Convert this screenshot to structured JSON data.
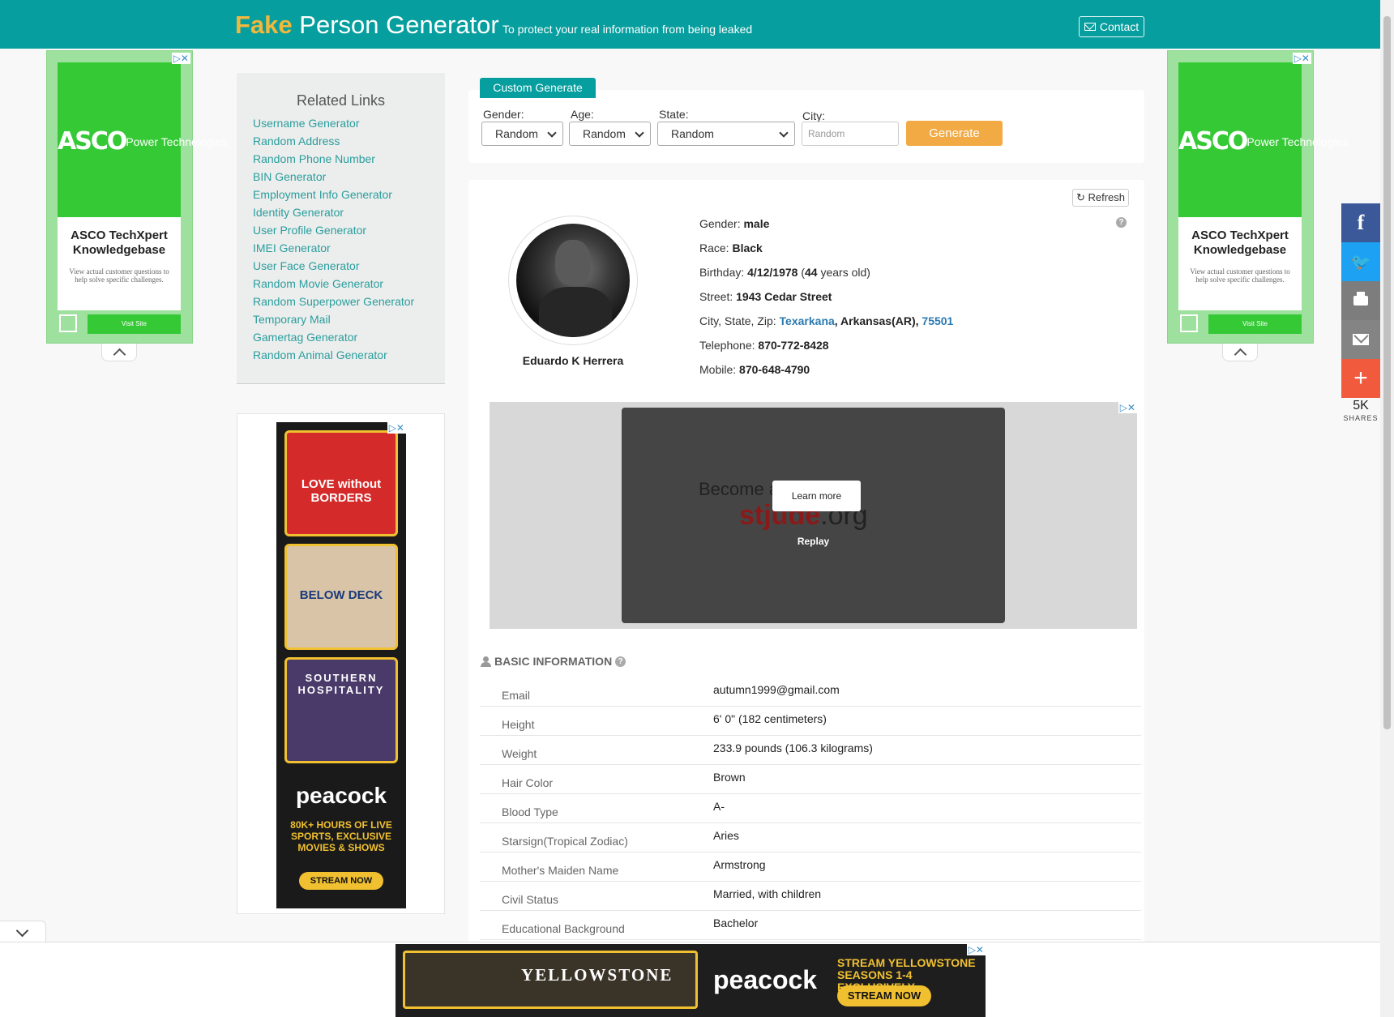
{
  "header": {
    "brand_fake": "Fake",
    "brand_rest": " Person Generator",
    "tagline": "To protect your real information from being leaked",
    "contact": "Contact"
  },
  "side_ads": {
    "logo_big": "ASCO",
    "logo_small": "Power Technologies",
    "title": "ASCO TechXpert Knowledgebase",
    "desc": "View actual customer questions to help solve specific challenges.",
    "visit": "Visit Site",
    "adchoice": "▷✕"
  },
  "related": {
    "title": "Related Links",
    "links": [
      "Username Generator",
      "Random Address",
      "Random Phone Number",
      "BIN Generator",
      "Employment Info Generator",
      "Identity Generator",
      "User Profile Generator",
      "IMEI Generator",
      "User Face Generator",
      "Random Movie Generator",
      "Random Superpower Generator",
      "Temporary Mail",
      "Gamertag Generator",
      "Random Animal Generator"
    ]
  },
  "sky_ad": {
    "img1": "LOVE without BORDERS",
    "img2": "BELOW DECK",
    "img3": "SOUTHERN HOSPITALITY",
    "logo": "peacock",
    "text": "80K+ HOURS OF LIVE SPORTS, EXCLUSIVE MOVIES & SHOWS",
    "cta": "STREAM NOW"
  },
  "custom": {
    "tab": "Custom Generate",
    "gender_label": "Gender:",
    "gender_value": "Random",
    "age_label": "Age:",
    "age_value": "Random",
    "state_label": "State:",
    "state_value": "Random",
    "city_label": "City:",
    "city_placeholder": "Random",
    "generate": "Generate"
  },
  "profile": {
    "refresh": "Refresh",
    "name": "Eduardo K Herrera",
    "gender_label": "Gender: ",
    "gender": "male",
    "race_label": "Race: ",
    "race": "Black",
    "birthday_label": "Birthday: ",
    "birthday": "4/12/1978",
    "age_open": " (",
    "age": "44",
    "age_close": " years old)",
    "street_label": "Street: ",
    "street": "1943 Cedar Street",
    "csz_label": "City, State, Zip: ",
    "city": "Texarkana",
    "state": ", Arkansas(AR), ",
    "zip": "75501",
    "tel_label": "Telephone: ",
    "tel": "870-772-8428",
    "mobile_label": "Mobile: ",
    "mobile": "870-648-4790"
  },
  "video_ad": {
    "text": "Become a donor at",
    "brand_red": "stjude",
    "brand_rest": ".org",
    "learn": "Learn more",
    "replay": "Replay"
  },
  "basic": {
    "title": "BASIC INFORMATION",
    "rows": [
      {
        "k": "Email",
        "v": "autumn1999@gmail.com"
      },
      {
        "k": "Height",
        "v": "6' 0\" (182 centimeters)"
      },
      {
        "k": "Weight",
        "v": "233.9 pounds (106.3 kilograms)"
      },
      {
        "k": "Hair Color",
        "v": "Brown"
      },
      {
        "k": "Blood Type",
        "v": "A-"
      },
      {
        "k": "Starsign(Tropical Zodiac)",
        "v": "Aries"
      },
      {
        "k": "Mother's Maiden Name",
        "v": "Armstrong"
      },
      {
        "k": "Civil Status",
        "v": "Married, with children"
      },
      {
        "k": "Educational Background",
        "v": "Bachelor"
      }
    ]
  },
  "share": {
    "count": "5K",
    "label": "SHARES"
  },
  "bottom_ad": {
    "show": "YELLOWSTONE",
    "logo": "peacock",
    "text": "STREAM YELLOWSTONE SEASONS 1-4 EXCLUSIVELY",
    "cta": "STREAM NOW"
  },
  "colors": {
    "header": "#069e9e",
    "accent": "#f2aa44",
    "link": "#2a9d9d"
  }
}
